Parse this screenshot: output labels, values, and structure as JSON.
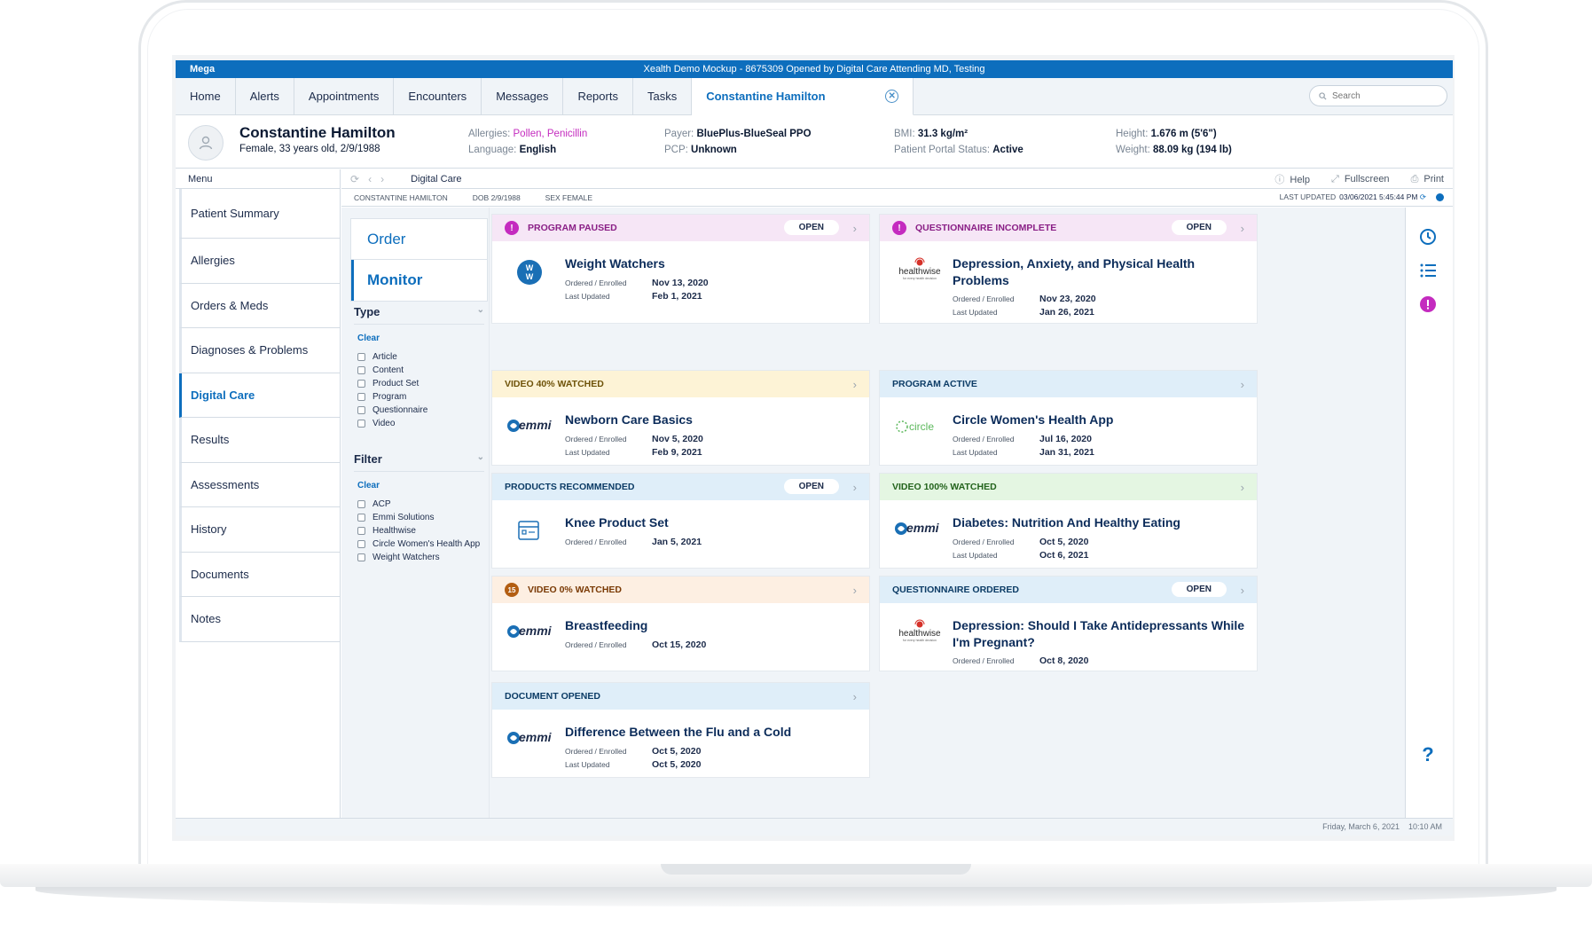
{
  "window": {
    "brand": "Mega",
    "title": "Xealth Demo Mockup - 8675309 Opened by Digital Care Attending MD, Testing"
  },
  "tabs": [
    {
      "label": "Home"
    },
    {
      "label": "Alerts"
    },
    {
      "label": "Appointments"
    },
    {
      "label": "Encounters"
    },
    {
      "label": "Messages"
    },
    {
      "label": "Reports"
    },
    {
      "label": "Tasks"
    },
    {
      "label": "Constantine Hamilton"
    }
  ],
  "search": {
    "placeholder": "Search"
  },
  "patient": {
    "name": "Constantine Hamilton",
    "info": "Female, 33 years old, 2/9/1988",
    "allergies_label": "Allergies:",
    "allergies": "Pollen, Penicillin",
    "language_label": "Language:",
    "language": "English",
    "payer_label": "Payer:",
    "payer": "BluePlus-BlueSeal PPO",
    "pcp_label": "PCP:",
    "pcp": "Unknown",
    "bmi_label": "BMI:",
    "bmi": "31.3 kg/m²",
    "portal_label": "Patient Portal Status:",
    "portal": "Active",
    "height_label": "Height:",
    "height": "1.676 m (5'6\")",
    "weight_label": "Weight:",
    "weight": "88.09 kg (194 lb)"
  },
  "menu_label": "Menu",
  "sidebar": {
    "items": [
      {
        "label": "Patient Summary"
      },
      {
        "label": "Allergies"
      },
      {
        "label": "Orders & Meds"
      },
      {
        "label": "Diagnoses & Problems"
      },
      {
        "label": "Digital Care"
      },
      {
        "label": "Results"
      },
      {
        "label": "Assessments"
      },
      {
        "label": "History"
      },
      {
        "label": "Documents"
      },
      {
        "label": "Notes"
      }
    ]
  },
  "crumb": {
    "title": "Digital Care",
    "help": "Help",
    "fullscreen": "Fullscreen",
    "print": "Print"
  },
  "infobar": {
    "name": "CONSTANTINE HAMILTON",
    "dob": "DOB 2/9/1988",
    "sex": "SEX FEMALE",
    "last_updated_label": "LAST UPDATED",
    "last_updated": "03/06/2021 5:45:44 PM"
  },
  "panel": {
    "order": "Order",
    "monitor": "Monitor",
    "type_title": "Type",
    "clear": "Clear",
    "type_options": [
      "Article",
      "Content",
      "Product Set",
      "Program",
      "Questionnaire",
      "Video"
    ],
    "filter_title": "Filter",
    "filter_options": [
      "ACP",
      "Emmi Solutions",
      "Healthwise",
      "Circle Women's Health App",
      "Weight Watchers"
    ]
  },
  "cards": [
    {
      "status": "PROGRAM PAUSED",
      "badge": "!",
      "open": "Open",
      "logo": "ww-logo",
      "title": "Weight Watchers",
      "ordered_label": "Ordered / Enrolled",
      "ordered": "Nov 13, 2020",
      "updated_label": "Last Updated",
      "updated": "Feb 1, 2021"
    },
    {
      "status": "QUESTIONNAIRE INCOMPLETE",
      "badge": "!",
      "open": "Open",
      "logo": "healthwise-logo",
      "title": "Depression, Anxiety, and Physical Health Problems",
      "ordered_label": "Ordered / Enrolled",
      "ordered": "Nov 23, 2020",
      "updated_label": "Last Updated",
      "updated": "Jan 26, 2021"
    },
    {
      "status": "VIDEO 40% WATCHED",
      "logo": "emmi-logo",
      "title": "Newborn Care Basics",
      "ordered_label": "Ordered / Enrolled",
      "ordered": "Nov 5, 2020",
      "updated_label": "Last Updated",
      "updated": "Feb 9, 2021"
    },
    {
      "status": "PROGRAM ACTIVE",
      "logo": "circle-logo",
      "title": "Circle Women's Health App",
      "ordered_label": "Ordered / Enrolled",
      "ordered": "Jul 16, 2020",
      "updated_label": "Last Updated",
      "updated": "Jan 31, 2021"
    },
    {
      "status": "PRODUCTS RECOMMENDED",
      "open": "Open",
      "logo": "product-box-icon",
      "title": "Knee Product Set",
      "ordered_label": "Ordered / Enrolled",
      "ordered": "Jan 5, 2021"
    },
    {
      "status": "VIDEO 100% WATCHED",
      "logo": "emmi-logo",
      "title": "Diabetes: Nutrition And Healthy Eating",
      "ordered_label": "Ordered / Enrolled",
      "ordered": "Oct 5, 2020",
      "updated_label": "Last Updated",
      "updated": "Oct 6, 2021"
    },
    {
      "status": "VIDEO 0% WATCHED",
      "badge": "15",
      "logo": "emmi-logo",
      "title": "Breastfeeding",
      "ordered_label": "Ordered / Enrolled",
      "ordered": "Oct 15, 2020"
    },
    {
      "status": "QUESTIONNAIRE ORDERED",
      "open": "Open",
      "logo": "healthwise-logo",
      "title": "Depression: Should I Take Antidepressants While I'm Pregnant?",
      "ordered_label": "Ordered / Enrolled",
      "ordered": "Oct 8, 2020"
    },
    {
      "status": "DOCUMENT OPENED",
      "logo": "emmi-logo",
      "title": "Difference Between the Flu and a Cold",
      "ordered_label": "Ordered / Enrolled",
      "ordered": "Oct 5, 2020",
      "updated_label": "Last Updated",
      "updated": "Oct 5, 2020"
    }
  ],
  "logos": {
    "emmi": "emmi",
    "healthwise": "healthwise",
    "healthwise_tag": "for every health decision",
    "circle": "circle"
  },
  "rail": {
    "help_glyph": "?"
  },
  "footer": {
    "date": "Friday, March 6, 2021",
    "time": "10:10 AM"
  },
  "colors": {
    "primary": "#0d6ebd",
    "alert_magenta": "#c42bbf",
    "badge_orange": "#b35e12"
  }
}
